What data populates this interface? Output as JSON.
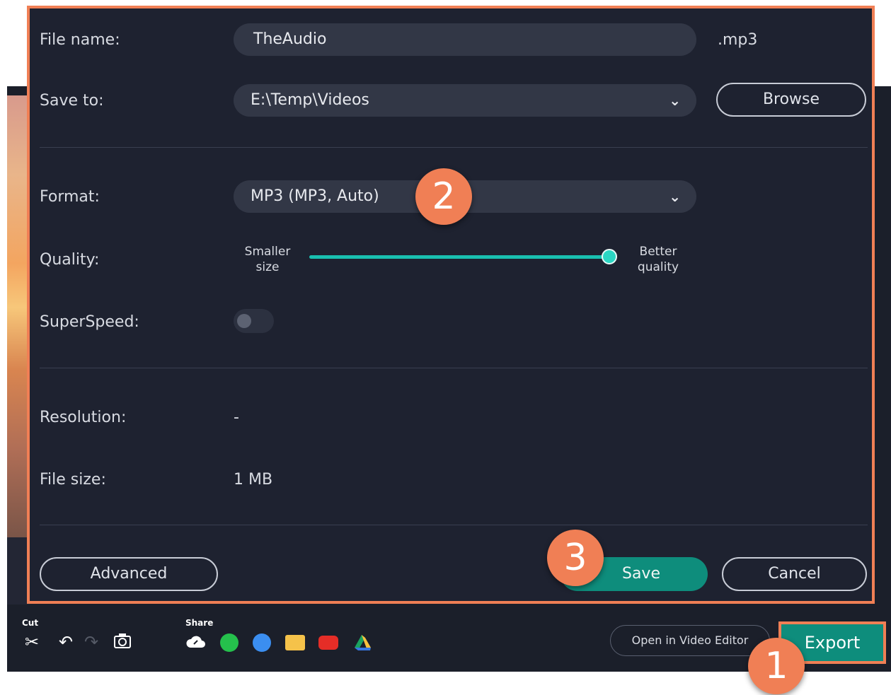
{
  "dialog": {
    "file_name": {
      "label": "File name:",
      "value": "TheAudio",
      "extension": ".mp3"
    },
    "save_to": {
      "label": "Save to:",
      "value": "E:\\Temp\\Videos",
      "browse_label": "Browse"
    },
    "format": {
      "label": "Format:",
      "value": "MP3 (MP3, Auto)"
    },
    "quality": {
      "label": "Quality:",
      "min_label_line1": "Smaller",
      "min_label_line2": "size",
      "max_label_line1": "Better",
      "max_label_line2": "quality",
      "level": 1.0
    },
    "superspeed": {
      "label": "SuperSpeed:",
      "enabled": false
    },
    "resolution": {
      "label": "Resolution:",
      "value": "-"
    },
    "file_size": {
      "label": "File size:",
      "value": "1 MB"
    },
    "buttons": {
      "advanced": "Advanced",
      "save": "Save",
      "cancel": "Cancel"
    }
  },
  "toolbar": {
    "cut_label": "Cut",
    "share_label": "Share",
    "open_editor_label": "Open in Video Editor",
    "export_label": "Export"
  },
  "annotations": {
    "badge_1": "1",
    "badge_2": "2",
    "badge_3": "3"
  },
  "colors": {
    "accent": "#0e8d7c",
    "highlight": "#f07f55",
    "slider": "#19c0b0",
    "dialog_bg": "#1e2230"
  }
}
